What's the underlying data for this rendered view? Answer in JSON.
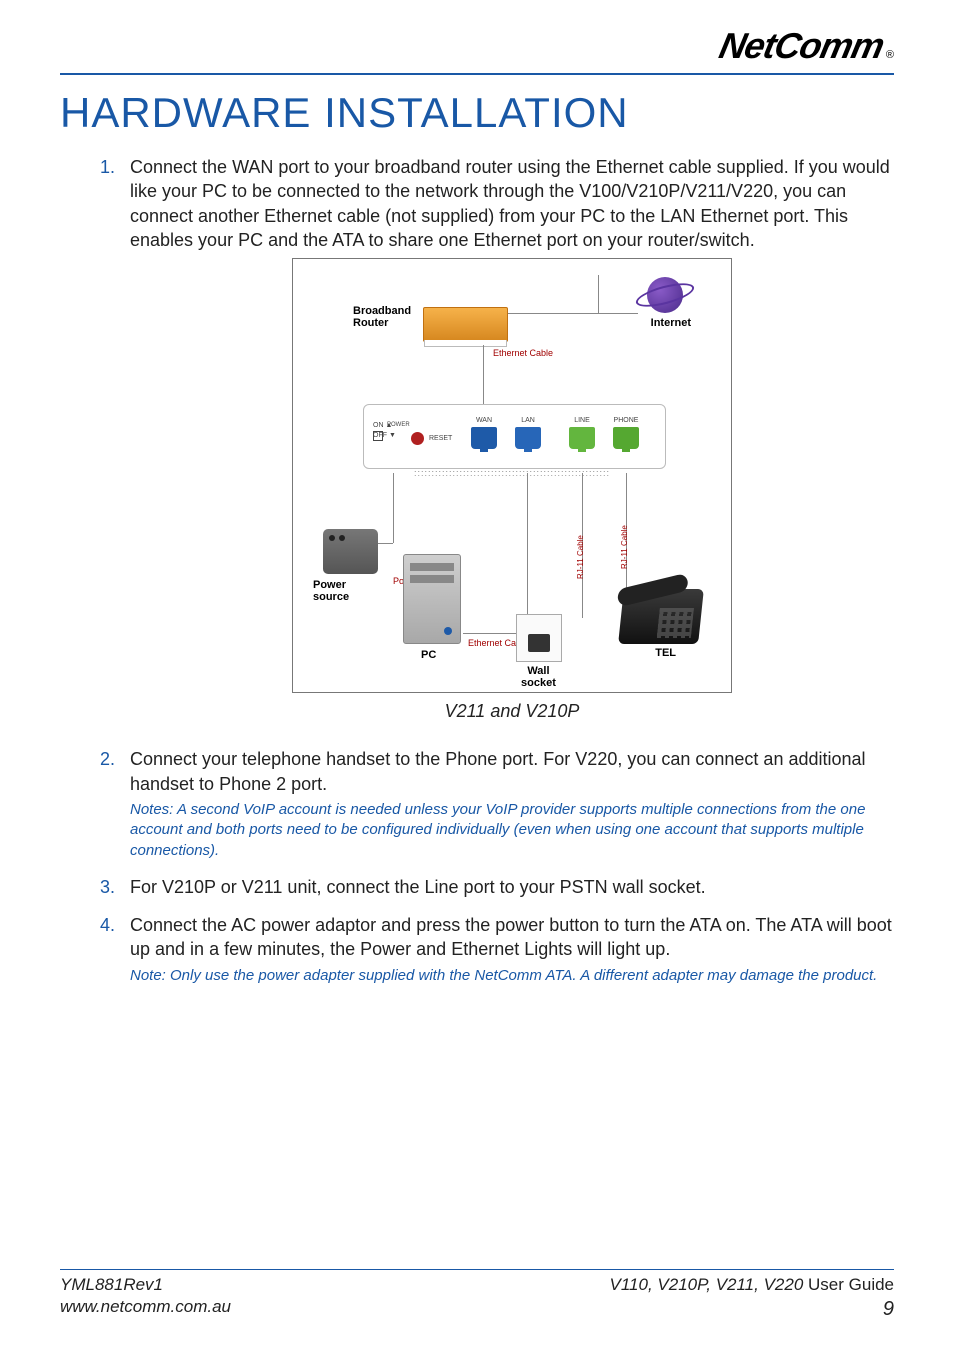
{
  "brand": {
    "name": "NetComm",
    "registered": "®"
  },
  "heading": "HARDWARE INSTALLATION",
  "steps": [
    {
      "num": "1.",
      "text": "Connect the WAN port to your broadband router using the Ethernet cable supplied. If you would like your PC to be connected to the network through the V100/V210P/V211/V220, you can connect another Ethernet cable (not supplied) from your PC to the LAN Ethernet port. This enables your PC and the ATA to share one Ethernet port on your router/switch.",
      "note": ""
    },
    {
      "num": "2.",
      "text": "Connect your telephone handset to the Phone port. For V220, you can connect an additional handset to Phone 2 port.",
      "note": "Notes:  A second VoIP account is needed unless your VoIP provider supports multiple connections from the one account and both ports need to be configured individually (even when using one account that supports multiple connections)."
    },
    {
      "num": "3.",
      "text": "For V210P or V211 unit, connect the Line port to your PSTN wall socket.",
      "note": ""
    },
    {
      "num": "4.",
      "text": "Connect the AC power adaptor and press the power button to turn the ATA on. The ATA will boot up and in a few minutes, the Power and Ethernet Lights will light up.",
      "note": "Note: Only use the power adapter supplied with the NetComm ATA. A different adapter may damage the product."
    }
  ],
  "diagram": {
    "caption": "V211 and V210P",
    "labels": {
      "broadband_router": "Broadband\nRouter",
      "internet": "Internet",
      "ethernet_cable_top": "Ethernet Cable",
      "ethernet_cable_bottom": "Ethernet Cable",
      "power_source": "Power\nsource",
      "power_supply": "Power Supply",
      "pc": "PC",
      "wall_socket": "Wall\nsocket",
      "tel": "TEL",
      "rj11_1": "RJ-11 Cable",
      "rj11_2": "RJ-11 Cable",
      "wan": "WAN",
      "lan": "LAN",
      "line": "LINE",
      "phone": "PHONE",
      "on_off": "ON ▲\nOFF ▼",
      "power_led": "POWER",
      "reset": "RESET"
    }
  },
  "footer": {
    "doc_rev": "YML881Rev1",
    "url": "www.netcomm.com.au",
    "guide_models": "V110, V210P, V211, V220",
    "guide_suffix": " User Guide",
    "page": "9"
  }
}
